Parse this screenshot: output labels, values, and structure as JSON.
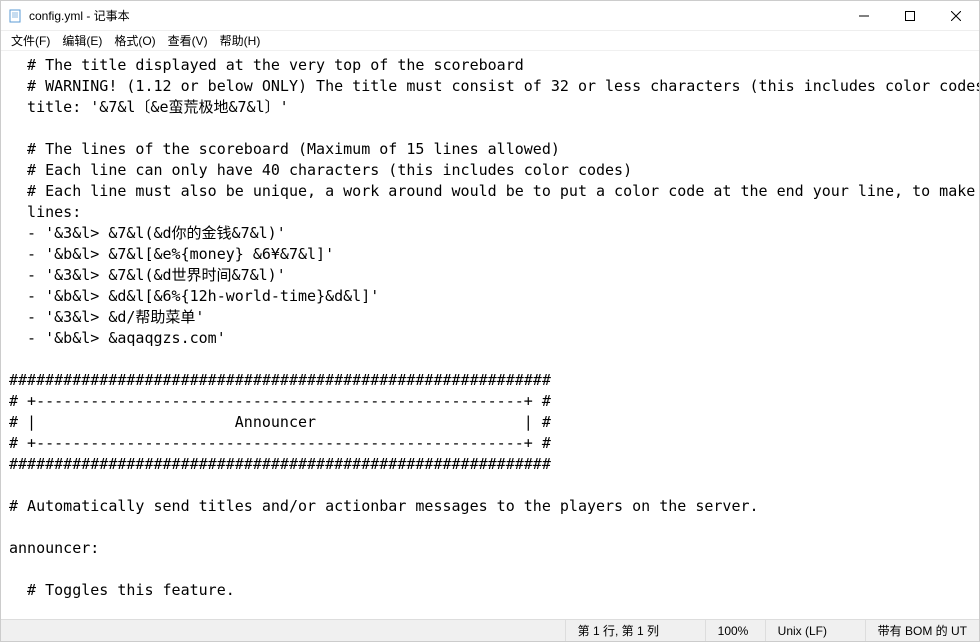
{
  "window": {
    "title": "config.yml - 记事本"
  },
  "menu": {
    "file": "文件(F)",
    "edit": "编辑(E)",
    "format": "格式(O)",
    "view": "查看(V)",
    "help": "帮助(H)"
  },
  "content": "  # The title displayed at the very top of the scoreboard\n  # WARNING! (1.12 or below ONLY) The title must consist of 32 or less characters (this includes color codes)\n  title: '&7&l〔&e蛮荒极地&7&l〕'\n\n  # The lines of the scoreboard (Maximum of 15 lines allowed)\n  # Each line can only have 40 characters (this includes color codes)\n  # Each line must also be unique, a work around would be to put a color code at the end your line, to make it unique.\n  lines:\n  - '&3&l> &7&l(&d你的金钱&7&l)'\n  - '&b&l> &7&l[&e%{money} &6¥&7&l]'\n  - '&3&l> &7&l(&d世界时间&7&l)'\n  - '&b&l> &d&l[&6%{12h-world-time}&d&l]'\n  - '&3&l> &d/帮助菜单'\n  - '&b&l> &aqaqgzs.com'\n\n############################################################\n# +------------------------------------------------------+ #\n# |                      Announcer                       | #\n# +------------------------------------------------------+ #\n############################################################\n\n# Automatically send titles and/or actionbar messages to the players on the server.\n\nannouncer:\n\n  # Toggles this feature.                                                                                                                                                                 ",
  "status": {
    "position": "第 1 行, 第 1 列",
    "zoom": "100%",
    "lineending": "Unix (LF)",
    "encoding": "带有 BOM 的 UT"
  }
}
